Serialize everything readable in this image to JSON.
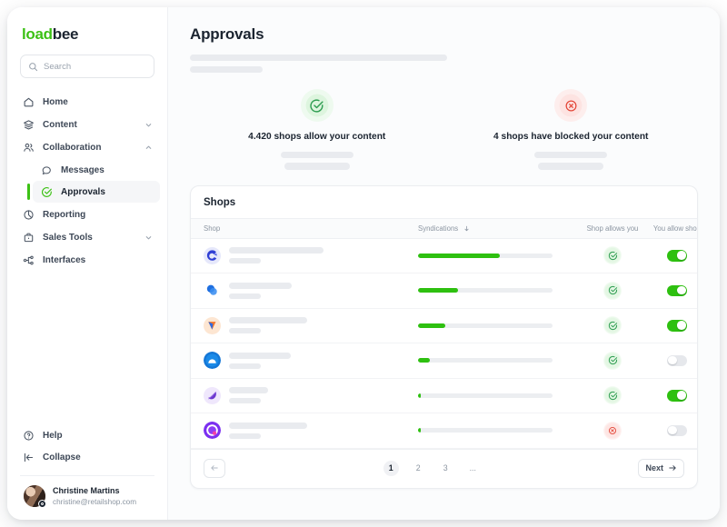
{
  "brand": {
    "part1": "load",
    "part2": "bee",
    "color_green": "#3cc115",
    "color_dark": "#1b2430"
  },
  "search": {
    "placeholder": "Search"
  },
  "sidebar": {
    "items": [
      {
        "label": "Home",
        "icon": "home-icon",
        "expandable": false
      },
      {
        "label": "Content",
        "icon": "layers-icon",
        "expandable": true
      },
      {
        "label": "Collaboration",
        "icon": "users-icon",
        "expandable": true,
        "expanded": true
      },
      {
        "label": "Messages",
        "icon": "message-icon",
        "sub": true
      },
      {
        "label": "Approvals",
        "icon": "check-circle-icon",
        "sub": true,
        "active": true
      },
      {
        "label": "Reporting",
        "icon": "pie-chart-icon",
        "expandable": false
      },
      {
        "label": "Sales Tools",
        "icon": "briefcase-icon",
        "expandable": true
      },
      {
        "label": "Interfaces",
        "icon": "nodes-icon",
        "expandable": false
      }
    ],
    "help_label": "Help",
    "collapse_label": "Collapse",
    "user": {
      "name": "Christine Martins",
      "email": "christine@retailshop.com"
    }
  },
  "header": {
    "title": "Approvals"
  },
  "stats": [
    {
      "caption": "4.420 shops allow your content",
      "icon": "check-circle-icon",
      "tone": "green"
    },
    {
      "caption": "4 shops have blocked your content",
      "icon": "x-circle-icon",
      "tone": "red"
    }
  ],
  "table": {
    "title": "Shops",
    "columns": [
      "Shop",
      "Syndications",
      "Shop allows you",
      "You allow shop"
    ],
    "sort_column": "Syndications",
    "sort_direction": "desc",
    "rows": [
      {
        "logo": "logo-c-blue",
        "name_width": 104,
        "sub_width": 35,
        "syndications_pct": 61,
        "shop_allows_you": "allowed",
        "you_allow_shop": true
      },
      {
        "logo": "logo-circles-blue",
        "name_width": 69,
        "sub_width": 35,
        "syndications_pct": 30,
        "shop_allows_you": "allowed",
        "you_allow_shop": true
      },
      {
        "logo": "logo-arrow-orange",
        "name_width": 86,
        "sub_width": 35,
        "syndications_pct": 20,
        "shop_allows_you": "allowed",
        "you_allow_shop": true
      },
      {
        "logo": "logo-cloud-blue",
        "name_width": 68,
        "sub_width": 35,
        "syndications_pct": 9,
        "shop_allows_you": "allowed",
        "you_allow_shop": false
      },
      {
        "logo": "logo-leaf-purple",
        "name_width": 43,
        "sub_width": 35,
        "syndications_pct": 2,
        "shop_allows_you": "allowed",
        "you_allow_shop": true
      },
      {
        "logo": "logo-ring-purple",
        "name_width": 86,
        "sub_width": 35,
        "syndications_pct": 2,
        "shop_allows_you": "blocked",
        "you_allow_shop": false
      }
    ]
  },
  "pagination": {
    "prev_icon": "arrow-left-icon",
    "pages": [
      "1",
      "2",
      "3",
      "..."
    ],
    "current_page": "1",
    "next_label": "Next"
  },
  "colors": {
    "green": "#2ec010",
    "red": "#e4483a",
    "skeleton": "#e9ebef",
    "track": "#eceef1"
  }
}
